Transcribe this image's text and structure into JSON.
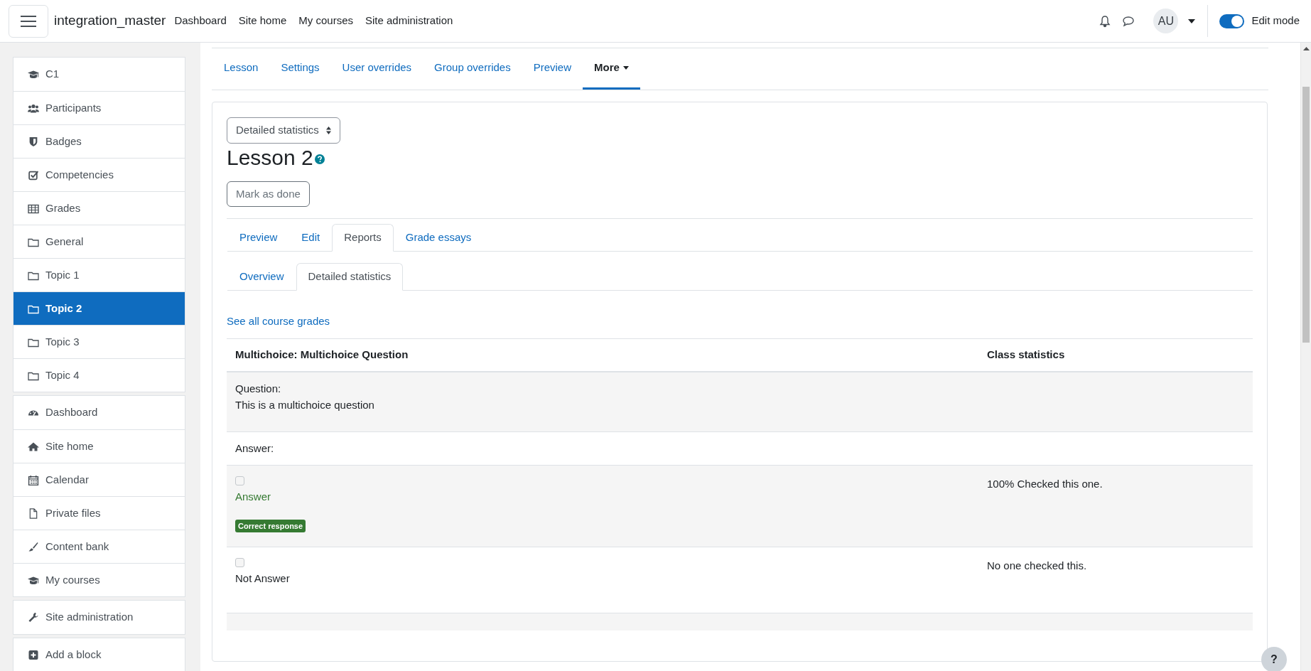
{
  "navbar": {
    "site_name": "integration_master",
    "links": [
      "Dashboard",
      "Site home",
      "My courses",
      "Site administration"
    ],
    "avatar": "AU",
    "edit_mode": {
      "label": "Edit mode",
      "on": true
    }
  },
  "sidebar": {
    "groups": [
      [
        {
          "label": "C1",
          "selected": false
        },
        {
          "label": "Participants",
          "selected": false
        },
        {
          "label": "Badges",
          "selected": false
        },
        {
          "label": "Competencies",
          "selected": false
        },
        {
          "label": "Grades",
          "selected": false
        },
        {
          "label": "General",
          "selected": false
        },
        {
          "label": "Topic 1",
          "selected": false
        },
        {
          "label": "Topic 2",
          "selected": true
        },
        {
          "label": "Topic 3",
          "selected": false
        },
        {
          "label": "Topic 4",
          "selected": false
        }
      ],
      [
        {
          "label": "Dashboard",
          "selected": false
        },
        {
          "label": "Site home",
          "selected": false
        },
        {
          "label": "Calendar",
          "selected": false
        },
        {
          "label": "Private files",
          "selected": false
        },
        {
          "label": "Content bank",
          "selected": false
        },
        {
          "label": "My courses",
          "selected": false
        }
      ],
      [
        {
          "label": "Site administration",
          "selected": false
        }
      ],
      [
        {
          "label": "Add a block",
          "selected": false
        }
      ]
    ]
  },
  "secondary_nav": [
    {
      "label": "Lesson",
      "selected": false
    },
    {
      "label": "Settings",
      "selected": false
    },
    {
      "label": "User overrides",
      "selected": false
    },
    {
      "label": "Group overrides",
      "selected": false
    },
    {
      "label": "Preview",
      "selected": false
    },
    {
      "label": "More",
      "selected": true,
      "kind": "dropdown"
    }
  ],
  "activity": {
    "select": "Detailed statistics",
    "title": "Lesson 2",
    "button": "Mark as done",
    "tabs": [
      {
        "label": "Preview",
        "selected": false
      },
      {
        "label": "Edit",
        "selected": false
      },
      {
        "label": "Reports",
        "selected": true
      },
      {
        "label": "Grade essays",
        "selected": false
      }
    ],
    "subtabs": [
      {
        "label": "Overview",
        "selected": false
      },
      {
        "label": "Detailed statistics",
        "selected": true
      }
    ],
    "link": "See all course grades",
    "table": {
      "columns": [
        "Multichoice: Multichoice Question",
        "Class statistics"
      ],
      "rows": [
        {
          "kind": "question",
          "label": "Question:",
          "text": "This is a multichoice question"
        },
        {
          "kind": "label",
          "text": "Answer:"
        },
        {
          "kind": "answer",
          "checked": false,
          "text": "Answer",
          "correct": true,
          "badge": "Correct response",
          "stat": "100% Checked this one."
        },
        {
          "kind": "answer",
          "checked": false,
          "text": "Not Answer",
          "correct": false,
          "stat": "No one checked this."
        },
        {
          "kind": "footer"
        }
      ]
    }
  },
  "help_button": "?"
}
